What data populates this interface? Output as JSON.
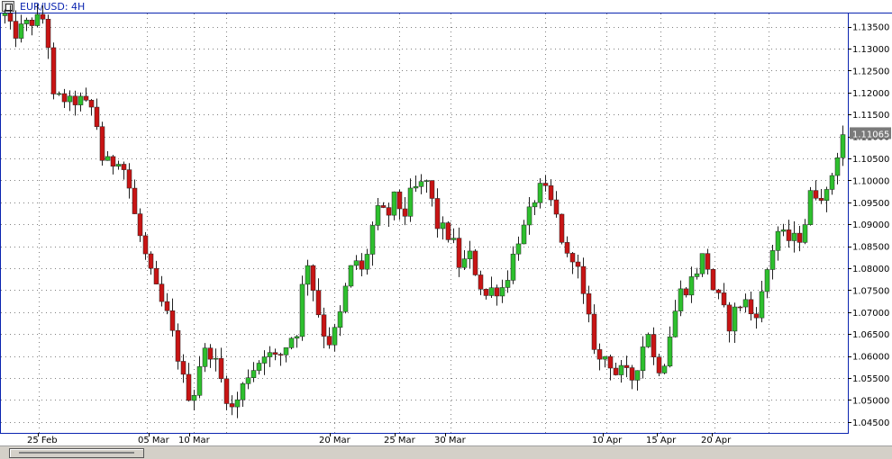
{
  "window": {
    "title": "EUR/USD: 4H"
  },
  "chart_data": {
    "type": "candlestick",
    "title": "EUR/USD: 4H",
    "ylim": [
      1.0425,
      1.138
    ],
    "y_ticks": [
      "1.04500",
      "1.05000",
      "1.05500",
      "1.06000",
      "1.06500",
      "1.07000",
      "1.07500",
      "1.08000",
      "1.08500",
      "1.09000",
      "1.09500",
      "1.10000",
      "1.10500",
      "1.11000",
      "1.11500",
      "1.12000",
      "1.12500",
      "1.13000",
      "1.13500"
    ],
    "last_price": "1.11065",
    "x_labels": [
      "25 Feb",
      "05 Mar",
      "10 Mar",
      "20 Mar",
      "25 Mar",
      "30 Mar",
      "10 Apr",
      "15 Apr",
      "20 Apr"
    ],
    "grid": true,
    "colors": {
      "up": "#2ec02e",
      "down": "#c81414",
      "axis": "#0a24b0",
      "grid": "#808080",
      "wick": "#202020",
      "price_tag": "#7a7a7a"
    },
    "close_path": [
      1.1375,
      1.133,
      1.1345,
      1.136,
      1.1365,
      1.137,
      1.118,
      1.119,
      1.1175,
      1.1185,
      1.117,
      1.116,
      1.1045,
      1.1035,
      1.1055,
      1.101,
      1.0915,
      1.0845,
      1.078,
      1.073,
      1.069,
      1.062,
      1.054,
      1.0495,
      1.059,
      1.062,
      1.058,
      1.052,
      1.0475,
      1.052,
      1.0565,
      1.058,
      1.0615,
      1.059,
      1.0605,
      1.064,
      1.066,
      1.0835,
      1.0745,
      1.066,
      1.063,
      1.0675,
      1.0765,
      1.0825,
      1.0785,
      1.0885,
      1.0935,
      1.0915,
      1.0965,
      1.0915,
      1.0975,
      1.0985,
      1.1,
      1.09,
      1.0885,
      1.0865,
      1.0795,
      1.0835,
      1.0785,
      1.0735,
      1.0755,
      1.075,
      1.0795,
      1.0865,
      1.0895,
      1.0955,
      1.0985,
      1.0955,
      1.0905,
      1.082,
      1.0835,
      1.074,
      1.066,
      1.0585,
      1.0605,
      1.056,
      1.0565,
      1.0545,
      1.0595,
      1.0665,
      1.057,
      1.0585,
      1.0675,
      1.0745,
      1.076,
      1.0795,
      1.0835,
      1.0755,
      1.072,
      1.067,
      1.0715,
      1.0725,
      1.0685,
      1.0735,
      1.0825,
      1.0885,
      1.0865,
      1.0865,
      1.0875,
      1.0965,
      1.0975,
      1.0965,
      1.104,
      1.1105
    ]
  }
}
